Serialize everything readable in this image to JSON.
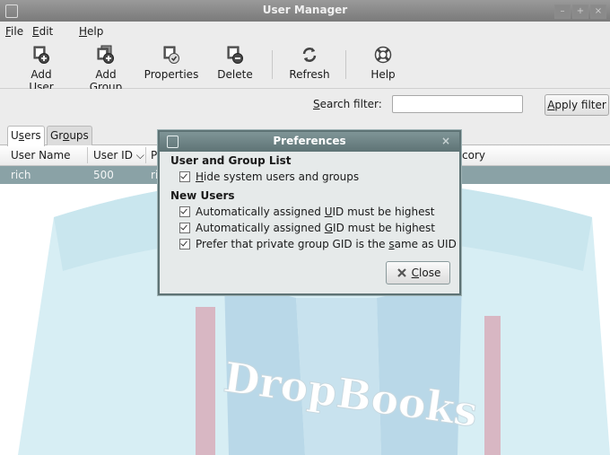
{
  "window": {
    "title": "User Manager",
    "buttons": [
      "–",
      "+",
      "×"
    ]
  },
  "menu": [
    {
      "mnemonic": "F",
      "rest": "ile"
    },
    {
      "mnemonic": "E",
      "rest": "dit"
    },
    {
      "mnemonic": "H",
      "rest": "elp"
    }
  ],
  "toolbar": {
    "add_user": "Add User",
    "add_group": "Add Group",
    "properties": "Properties",
    "delete": "Delete",
    "refresh": "Refresh",
    "help": "Help"
  },
  "search": {
    "label_mnemonic": "S",
    "label_rest": "earch filter:",
    "value": "",
    "apply_mnemonic": "A",
    "apply_rest": "pply filter"
  },
  "tabs": [
    {
      "pre": "U",
      "mn": "s",
      "post": "ers",
      "active": true
    },
    {
      "pre": "Gr",
      "mn": "o",
      "post": "ups",
      "active": false
    }
  ],
  "table": {
    "columns": [
      "User Name",
      "User ID ⌵",
      "P",
      "cory"
    ],
    "rows": [
      {
        "name": "rich",
        "uid": "500",
        "p": "ri"
      }
    ]
  },
  "background_text": "DropBooks",
  "dialog": {
    "title": "Preferences",
    "close_glyph": "×",
    "section1": "User and Group List",
    "opt_hide_mn": "H",
    "opt_hide_rest": "ide system users and groups",
    "section2": "New Users",
    "opt_uid_pre": "Automatically assigned ",
    "opt_uid_mn": "U",
    "opt_uid_post": "ID must be highest",
    "opt_gid_pre": "Automatically assigned ",
    "opt_gid_mn": "G",
    "opt_gid_post": "ID must be highest",
    "opt_same_pre": "Prefer that private group GID is the ",
    "opt_same_mn": "s",
    "opt_same_post": "ame as UID",
    "close_mn": "C",
    "close_rest": "lose"
  },
  "colors": {
    "selection": "#8aa2a6",
    "dialog_title": "#5e7375",
    "watermark": "#d7eef4"
  }
}
